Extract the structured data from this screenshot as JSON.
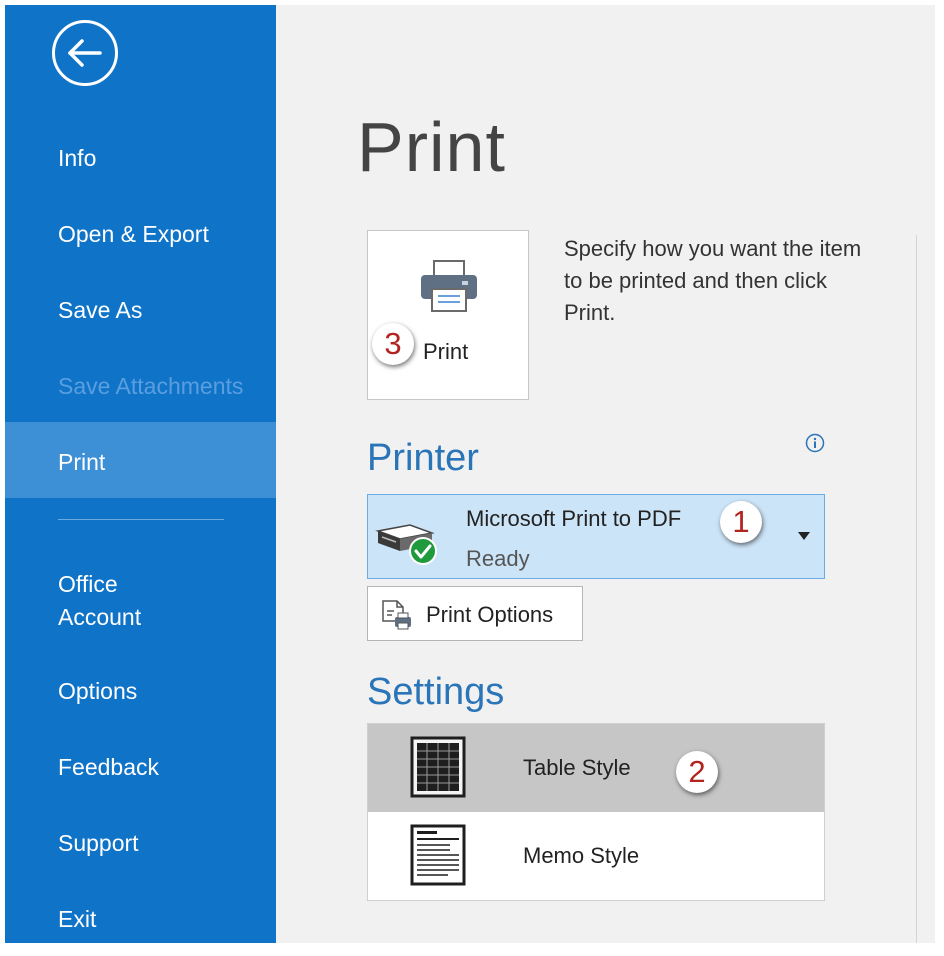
{
  "sidebar": {
    "items": [
      {
        "label": "Info"
      },
      {
        "label": "Open & Export"
      },
      {
        "label": "Save As"
      },
      {
        "label": "Save Attachments"
      },
      {
        "label": "Print"
      },
      {
        "label": "Office Account"
      },
      {
        "label": "Options"
      },
      {
        "label": "Feedback"
      },
      {
        "label": "Support"
      },
      {
        "label": "Exit"
      }
    ],
    "selected": "Print",
    "disabled": "Save Attachments"
  },
  "page": {
    "title": "Print"
  },
  "print_button": {
    "label": "Print",
    "step": "3"
  },
  "description": "Specify how you want the item to be printed and then click Print.",
  "printer": {
    "section_title": "Printer",
    "name": "Microsoft Print to PDF",
    "status": "Ready",
    "step": "1",
    "options_label": "Print Options"
  },
  "settings": {
    "section_title": "Settings",
    "styles": [
      {
        "label": "Table Style",
        "selected": true,
        "step": "2"
      },
      {
        "label": "Memo Style",
        "selected": false
      }
    ]
  },
  "colors": {
    "sidebar": "#0f73c8",
    "sidebar_selected": "#3d8fd6",
    "accent_text": "#2a74b8",
    "printer_selected": "#cce4f7",
    "step_badge": "#b2241f"
  }
}
